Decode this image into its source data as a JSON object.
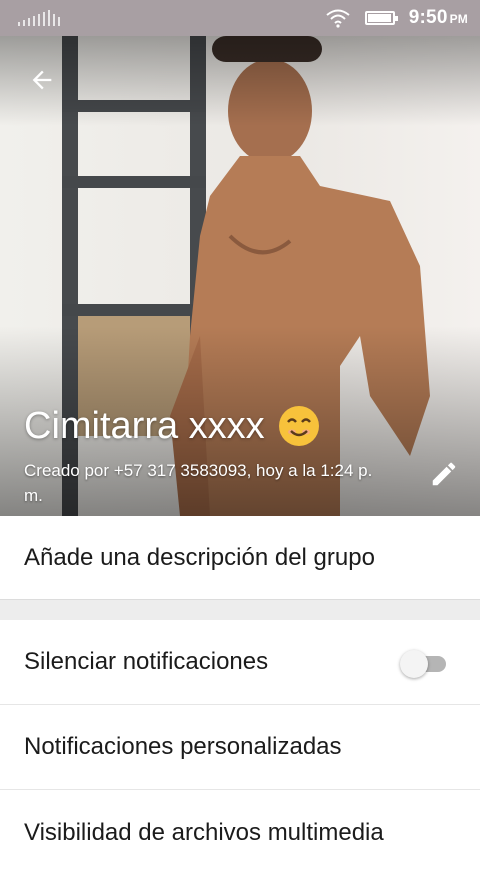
{
  "status_bar": {
    "time": "9:50",
    "ampm": "PM",
    "icons": [
      "signal-icon",
      "wifi-icon",
      "battery-icon"
    ]
  },
  "header": {
    "back_icon": "arrow-left-icon",
    "title": "Cimitarra xxxx",
    "title_emoji": "smiling-face-icon",
    "created_by": "Creado por +57 317 3583093, hoy a la 1:24 p. m.",
    "edit_icon": "pencil-icon"
  },
  "description": {
    "label": "Añade una descripción del grupo"
  },
  "settings": {
    "items": [
      {
        "label": "Silenciar notificaciones",
        "toggle": false
      },
      {
        "label": "Notificaciones personalizadas"
      },
      {
        "label": "Visibilidad de archivos multimedia"
      }
    ]
  },
  "colors": {
    "status_bar": "#a89fa3",
    "divider": "#ededed",
    "text_primary": "#1b1b1b",
    "toggle_track": "#b5b5b5"
  }
}
